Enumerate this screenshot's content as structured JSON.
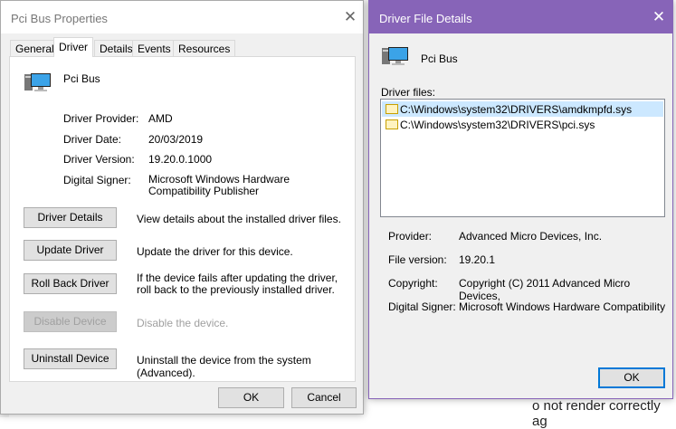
{
  "background": {
    "text": "o not render correctly ag"
  },
  "properties": {
    "title": "Pci Bus Properties",
    "tabs": [
      "General",
      "Driver",
      "Details",
      "Events",
      "Resources"
    ],
    "device_name": "Pci Bus",
    "fields": [
      {
        "label": "Driver Provider:",
        "value": "AMD"
      },
      {
        "label": "Driver Date:",
        "value": "20/03/2019"
      },
      {
        "label": "Driver Version:",
        "value": "19.20.0.1000"
      },
      {
        "label": "Digital Signer:",
        "value": "Microsoft Windows Hardware Compatibility Publisher"
      }
    ],
    "actions": [
      {
        "button": "Driver Details",
        "desc": "View details about the installed driver files."
      },
      {
        "button": "Update Driver",
        "desc": "Update the driver for this device."
      },
      {
        "button": "Roll Back Driver",
        "desc": "If the device fails after updating the driver, roll back to the previously installed driver."
      },
      {
        "button": "Disable Device",
        "desc": "Disable the device."
      },
      {
        "button": "Uninstall Device",
        "desc": "Uninstall the device from the system (Advanced)."
      }
    ],
    "ok": "OK",
    "cancel": "Cancel"
  },
  "file_details": {
    "title": "Driver File Details",
    "accent": "#8764b8",
    "device_name": "Pci Bus",
    "files_label": "Driver files:",
    "files": [
      "C:\\Windows\\system32\\DRIVERS\\amdkmpfd.sys",
      "C:\\Windows\\system32\\DRIVERS\\pci.sys"
    ],
    "info": [
      {
        "label": "Provider:",
        "value": "Advanced Micro Devices, Inc."
      },
      {
        "label": "File version:",
        "value": "19.20.1"
      },
      {
        "label": "Copyright:",
        "value": "Copyright (C) 2011 Advanced Micro Devices,"
      },
      {
        "label": "Digital Signer:",
        "value": "Microsoft Windows Hardware Compatibility"
      }
    ],
    "ok": "OK"
  }
}
